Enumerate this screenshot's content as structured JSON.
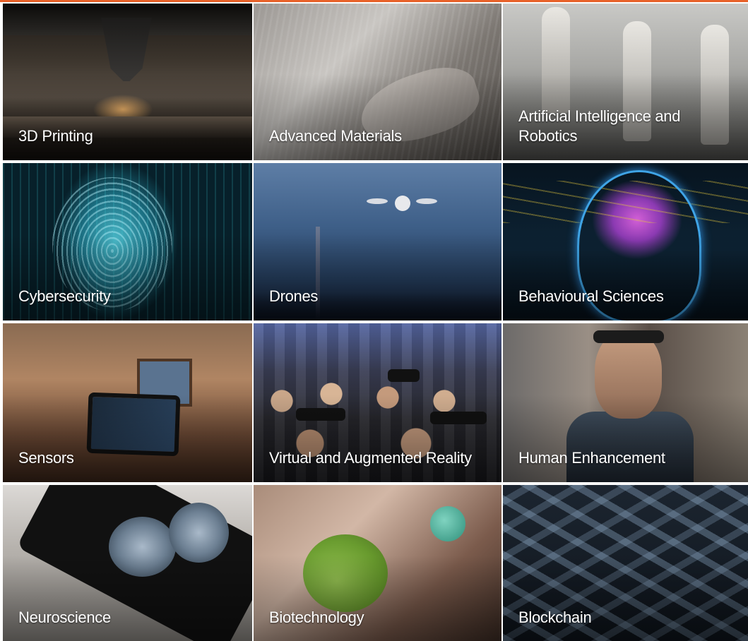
{
  "tiles": [
    {
      "label": "3D Printing"
    },
    {
      "label": "Advanced Materials"
    },
    {
      "label": "Artificial Intelligence and Robotics"
    },
    {
      "label": "Cybersecurity"
    },
    {
      "label": "Drones"
    },
    {
      "label": "Behavioural Sciences"
    },
    {
      "label": "Sensors"
    },
    {
      "label": "Virtual and Augmented Reality"
    },
    {
      "label": "Human Enhancement"
    },
    {
      "label": "Neuroscience"
    },
    {
      "label": "Biotechnology"
    },
    {
      "label": "Blockchain"
    }
  ],
  "colors": {
    "accent": "#e8622a",
    "label_text": "#ffffff"
  }
}
